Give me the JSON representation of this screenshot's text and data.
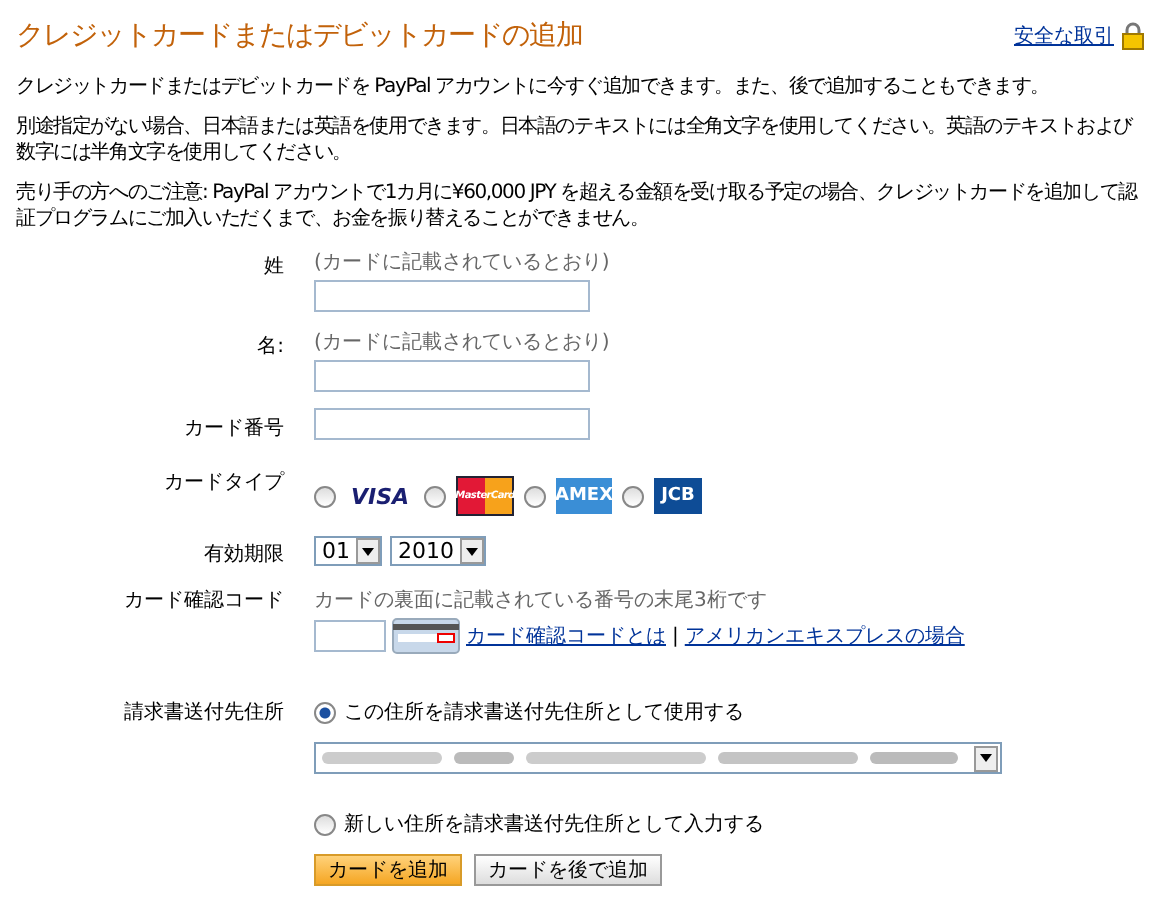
{
  "header": {
    "title": "クレジットカードまたはデビットカードの追加",
    "secure_link": "安全な取引"
  },
  "paragraphs": [
    "クレジットカードまたはデビットカードを PayPal アカウントに今すぐ追加できます。また、後で追加することもできます。",
    "別途指定がない場合、日本語または英語を使用できます。日本語のテキストには全角文字を使用してください。英語のテキストおよび数字には半角文字を使用してください。",
    "売り手の方へのご注意: PayPal アカウントで1カ月に¥60,000 JPY を超える金額を受け取る予定の場合、クレジットカードを追加して認証プログラムにご加入いただくまで、お金を振り替えることができません。"
  ],
  "last_name": {
    "label": "姓",
    "hint": "(カードに記載されているとおり)"
  },
  "first_name": {
    "label": "名:",
    "hint": "(カードに記載されているとおり)"
  },
  "card_number": {
    "label": "カード番号"
  },
  "card_type": {
    "label": "カードタイプ",
    "options": [
      {
        "kind": "visa",
        "logo": "VISA",
        "selected": false
      },
      {
        "kind": "mastercard",
        "logo": "MasterCard",
        "selected": false
      },
      {
        "kind": "amex",
        "logo": "AMEX",
        "selected": false
      },
      {
        "kind": "jcb",
        "logo": "JCB",
        "selected": false
      }
    ]
  },
  "expiry": {
    "label": "有効期限",
    "month": "01",
    "year": "2010"
  },
  "cvv": {
    "label": "カード確認コード",
    "hint": "カードの裏面に記載されている番号の末尾3桁です",
    "links": [
      "カード確認コードとは",
      "アメリカンエキスプレスの場合"
    ],
    "separator": "|"
  },
  "billing": {
    "label": "請求書送付先住所",
    "options": [
      {
        "label": "この住所を請求書送付先住所として使用する",
        "selected": true
      },
      {
        "label": "新しい住所を請求書送付先住所として入力する",
        "selected": false
      }
    ]
  },
  "buttons": [
    {
      "label": "カードを追加",
      "primary": true
    },
    {
      "label": "カードを後で追加",
      "primary": false
    }
  ]
}
